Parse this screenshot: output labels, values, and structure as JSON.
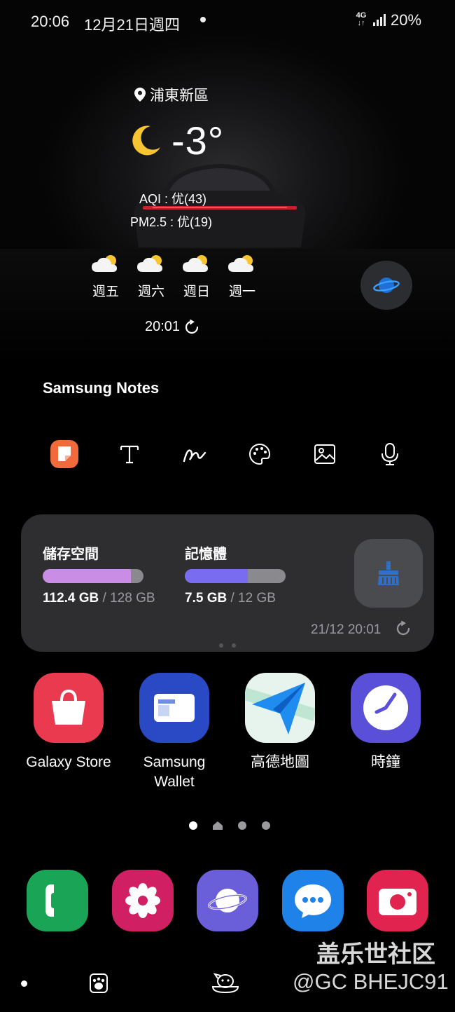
{
  "status_bar": {
    "time": "20:06",
    "date": "12月21日週四",
    "network": "4G",
    "battery": "20%"
  },
  "weather": {
    "location": "浦東新區",
    "temperature": "-3°",
    "condition_icon": "moon-icon",
    "aqi": "AQI : 优(43)",
    "pm25": "PM2.5 : 优(19)",
    "forecast": [
      {
        "day": "週五",
        "icon": "partly-cloudy-icon"
      },
      {
        "day": "週六",
        "icon": "partly-cloudy-icon"
      },
      {
        "day": "週日",
        "icon": "partly-cloudy-icon"
      },
      {
        "day": "週一",
        "icon": "partly-cloudy-icon"
      }
    ],
    "updated": "20:01"
  },
  "notes_widget": {
    "title": "Samsung Notes",
    "tools": [
      "new-note-icon",
      "text-icon",
      "handwriting-icon",
      "palette-icon",
      "image-icon",
      "microphone-icon"
    ]
  },
  "storage_widget": {
    "storage_label": "儲存空間",
    "storage_used": "112.4 GB",
    "storage_total": " / 128 GB",
    "storage_fraction": 0.878,
    "memory_label": "記憶體",
    "memory_used": "7.5 GB",
    "memory_total": " / 12 GB",
    "memory_fraction": 0.625,
    "timestamp": "21/12 20:01"
  },
  "apps": [
    {
      "label": "Galaxy Store",
      "icon": "galaxy-store-icon"
    },
    {
      "label": "Samsung Wallet",
      "icon": "samsung-wallet-icon"
    },
    {
      "label": "高德地圖",
      "icon": "amap-icon"
    },
    {
      "label": "時鐘",
      "icon": "clock-icon"
    }
  ],
  "dock": [
    "phone-icon",
    "gallery-icon",
    "internet-icon",
    "messages-icon",
    "camera-icon"
  ],
  "watermark": {
    "line1": "盖乐世社区",
    "line2": "@GC BHEJC91"
  },
  "colors": {
    "storage_bar": "#c98de6",
    "memory_bar": "#7a6cf0",
    "galaxy_store": "#e93a4f",
    "samsung_wallet": "#2a49c4",
    "clock": "#5a4fd8",
    "phone": "#1aa556",
    "gallery": "#d01f63",
    "internet": "#6a5fd8",
    "messages": "#1f82e9",
    "camera": "#e0234f"
  }
}
